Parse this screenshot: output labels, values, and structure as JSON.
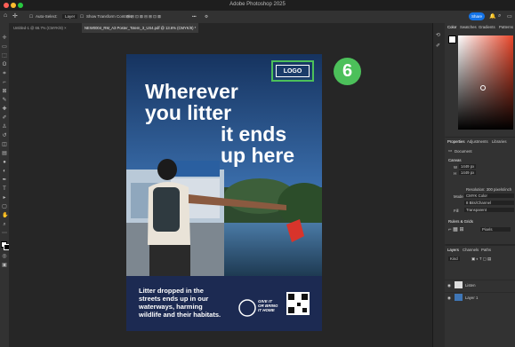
{
  "app": {
    "title": "Adobe Photoshop 2025",
    "share_label": "Share",
    "traffic_colors": [
      "#ff5f57",
      "#febc2e",
      "#28c840"
    ]
  },
  "options": {
    "auto_select": "Auto-Select:",
    "layer": "Layer",
    "show_transform": "Show Transform Controls",
    "more": "•••"
  },
  "tabs": [
    {
      "label": "Untitled-1 @ 66.7% (CMYK/8) ×"
    },
    {
      "label": "NEW0004_RM_A3 Poster_Totem_3_US4.pdf @ 13.6% (CMYK/8) *"
    }
  ],
  "color_panel": {
    "tabs": [
      "Color",
      "Swatches",
      "Gradients",
      "Patterns"
    ]
  },
  "properties": {
    "tabs": [
      "Properties",
      "Adjustments",
      "Libraries"
    ],
    "document_label": "Document",
    "canvas_header": "Canvas",
    "w_label": "W",
    "w_value": "1449 px",
    "h_label": "H",
    "h_value": "1449 px",
    "resolution": "Resolution: 300 pixels/inch",
    "mode_label": "Mode",
    "mode_value": "CMYK Color",
    "bitdepth_value": "8 Bits/Channel",
    "fill_label": "Fill",
    "fill_value": "Transparent",
    "rulers_header": "Rulers & Grids",
    "pixels_value": "Pixels"
  },
  "layers": {
    "tabs": [
      "Layers",
      "Channels",
      "Paths"
    ],
    "kind_label": "Kind",
    "items": [
      {
        "name": "Listen"
      },
      {
        "name": "Layer 1"
      }
    ]
  },
  "poster": {
    "logo": "LOGO",
    "badge": "6",
    "headline_1": "Wherever",
    "headline_2": "you litter",
    "headline_3": "it ends",
    "headline_4": "up here",
    "body_1": "Litter dropped in the",
    "body_2": "streets ends up in our",
    "body_3": "waterways, harming",
    "body_4": "wildlife and their habitats.",
    "tagline_1": "GIVE IT",
    "tagline_2": "OR BRING",
    "tagline_3": "IT HOME",
    "colors": {
      "headline": "#ffffff",
      "logo_border": "#4cc05a",
      "badge": "#4cc05a",
      "sky": "#3f76b6"
    }
  }
}
